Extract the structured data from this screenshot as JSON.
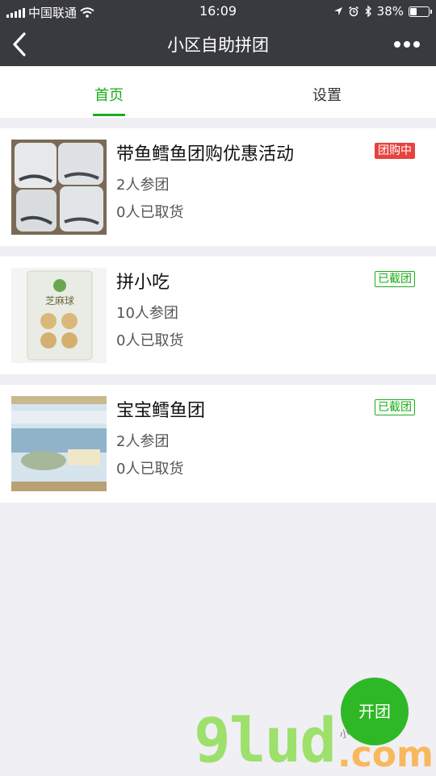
{
  "status_bar": {
    "carrier": "中国联通",
    "time": "16:09",
    "battery": "38%",
    "battery_level": 0.38,
    "icons": [
      "signal-icon",
      "wifi-icon",
      "location-arrow-icon",
      "alarm-icon",
      "bluetooth-icon",
      "battery-icon"
    ]
  },
  "nav": {
    "title": "小区自助拼团",
    "back_icon": "chevron-left-icon",
    "more_icon": "more-dots-icon"
  },
  "tabs": [
    {
      "label": "首页",
      "active": true
    },
    {
      "label": "设置",
      "active": false
    }
  ],
  "groups": [
    {
      "title": "带鱼鳕鱼团购优惠活动",
      "joined": "2人参团",
      "picked": "0人已取货",
      "status": "团购中",
      "status_color": "#e64340"
    },
    {
      "title": "拼小吃",
      "joined": "10人参团",
      "picked": "0人已取货",
      "status": "已截团",
      "status_color": "#1aad19"
    },
    {
      "title": "宝宝鳕鱼团",
      "joined": "2人参团",
      "picked": "0人已取货",
      "status": "已截团",
      "status_color": "#1aad19"
    }
  ],
  "fab": {
    "label": "开团"
  },
  "watermark": {
    "text1": "9lud",
    "text2": ".com",
    "text3": "小程序商店"
  },
  "colors": {
    "accent": "#1aad19",
    "header_bg": "#393a3f",
    "page_bg": "#efeff4"
  }
}
